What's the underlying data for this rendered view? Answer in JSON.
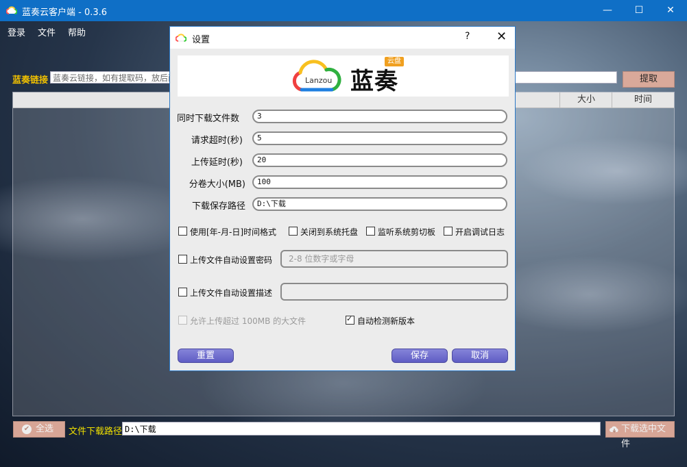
{
  "app": {
    "title": "蓝奏云客户端 - 0.3.6",
    "window_controls": {
      "minimize": "—",
      "maximize": "☐",
      "close": "✕"
    },
    "menu": [
      "登录",
      "文件",
      "帮助"
    ]
  },
  "link_bar": {
    "label": "蓝奏链接",
    "placeholder": "蓝奏云链接，如有提取码，放后面",
    "extract_label": "提取"
  },
  "table": {
    "columns": [
      "大小",
      "时间"
    ]
  },
  "bottom_bar": {
    "select_all_label": "全选",
    "download_path_label": "文件下载路径",
    "download_path_value": "D:\\下载",
    "download_selected_label": "下载选中文件"
  },
  "settings": {
    "title": "设置",
    "help": "?",
    "close": "✕",
    "logo": {
      "brand_small": "Lanzou",
      "brand_big": "蓝奏",
      "badge": "云盘"
    },
    "fields": [
      {
        "label": "同时下载文件数",
        "value": "3"
      },
      {
        "label": "请求超时(秒)",
        "value": "5"
      },
      {
        "label": "上传延时(秒)",
        "value": "20"
      },
      {
        "label": "分卷大小(MB)",
        "value": "100"
      },
      {
        "label": "下载保存路径",
        "value": "D:\\下载"
      }
    ],
    "options": [
      {
        "label": "使用[年-月-日]时间格式",
        "checked": false
      },
      {
        "label": "关闭到系统托盘",
        "checked": false
      },
      {
        "label": "监听系统剪切板",
        "checked": false
      },
      {
        "label": "开启调试日志",
        "checked": false
      }
    ],
    "auto_password": {
      "label": "上传文件自动设置密码",
      "checked": false,
      "placeholder": "2-8 位数字或字母"
    },
    "auto_desc": {
      "label": "上传文件自动设置描述",
      "checked": false,
      "value": ""
    },
    "allow_big": {
      "label": "允许上传超过 100MB 的大文件",
      "checked": false,
      "disabled": true
    },
    "auto_update": {
      "label": "自动检测新版本",
      "checked": true
    },
    "buttons": {
      "reset": "重置",
      "save": "保存",
      "cancel": "取消"
    }
  },
  "colors": {
    "titlebar": "#0f6fc6",
    "accent_yellow": "#f0c000",
    "button_salmon": "#d9a99a",
    "dialog_button": "#6a68cc"
  }
}
